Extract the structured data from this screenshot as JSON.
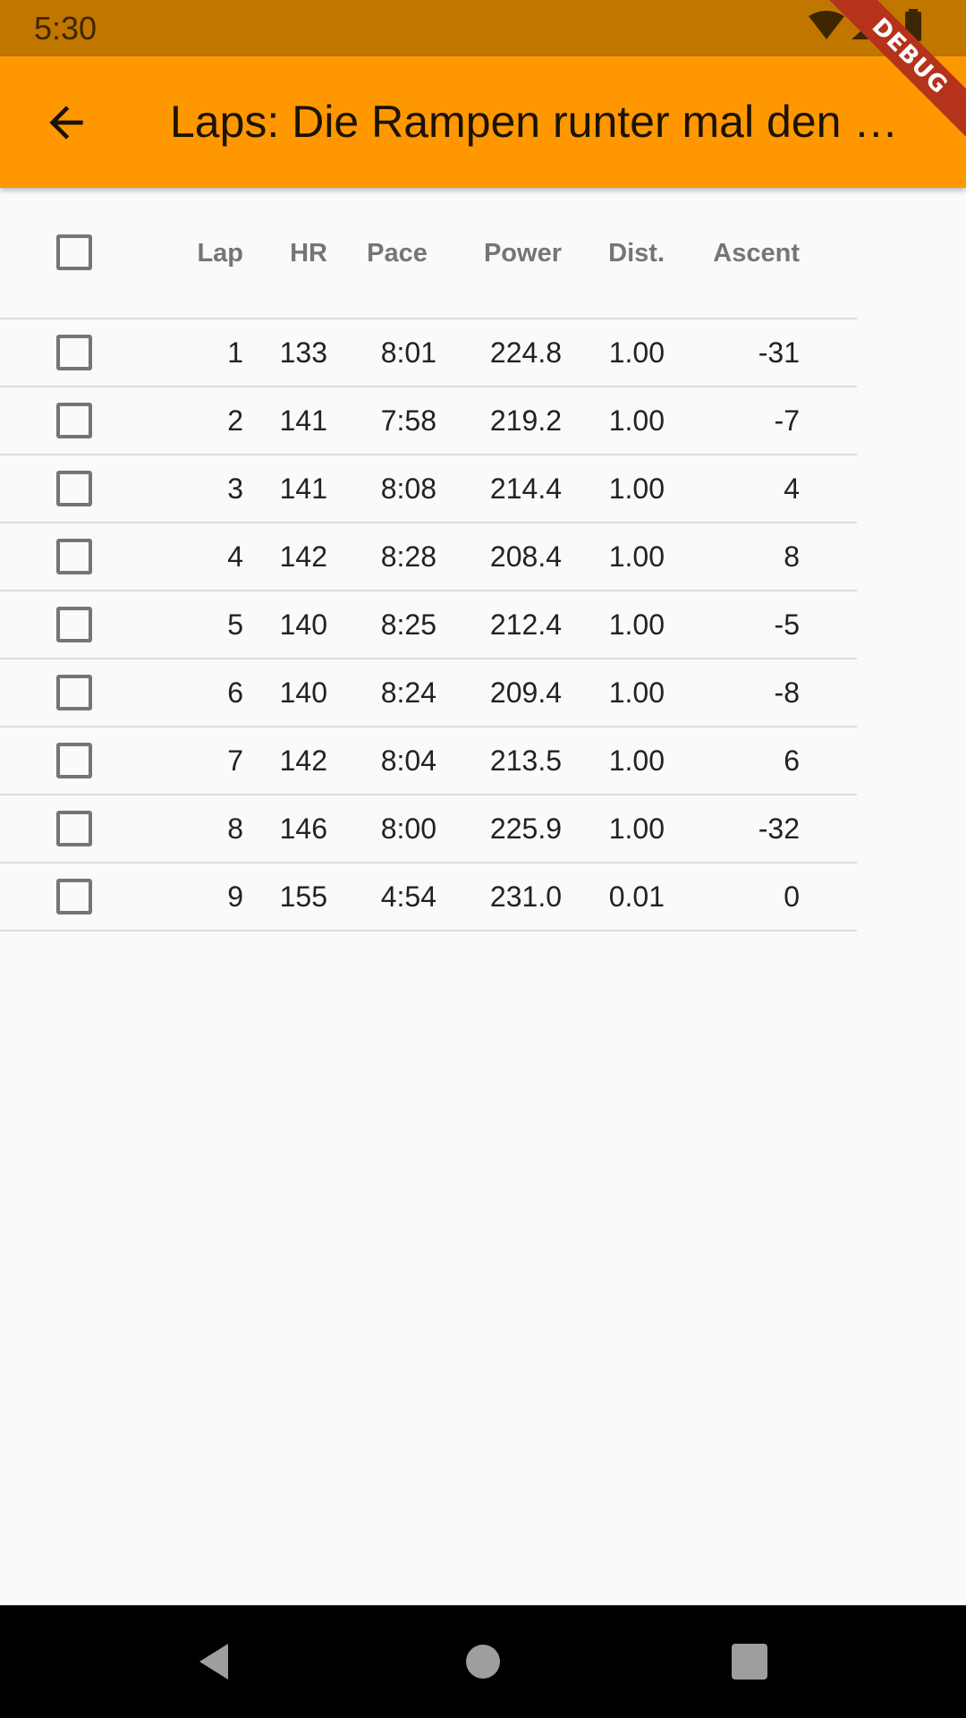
{
  "status_bar": {
    "time": "5:30"
  },
  "app_bar": {
    "title": "Laps: Die Rampen runter mal den …"
  },
  "debug_banner": {
    "label": "DEBUG"
  },
  "table": {
    "columns": [
      "Lap",
      "HR",
      "Pace",
      "Power",
      "Dist.",
      "Ascent"
    ],
    "rows": [
      {
        "lap": "1",
        "hr": "133",
        "pace": "8:01",
        "power": "224.8",
        "dist": "1.00",
        "ascent": "-31"
      },
      {
        "lap": "2",
        "hr": "141",
        "pace": "7:58",
        "power": "219.2",
        "dist": "1.00",
        "ascent": "-7"
      },
      {
        "lap": "3",
        "hr": "141",
        "pace": "8:08",
        "power": "214.4",
        "dist": "1.00",
        "ascent": "4"
      },
      {
        "lap": "4",
        "hr": "142",
        "pace": "8:28",
        "power": "208.4",
        "dist": "1.00",
        "ascent": "8"
      },
      {
        "lap": "5",
        "hr": "140",
        "pace": "8:25",
        "power": "212.4",
        "dist": "1.00",
        "ascent": "-5"
      },
      {
        "lap": "6",
        "hr": "140",
        "pace": "8:24",
        "power": "209.4",
        "dist": "1.00",
        "ascent": "-8"
      },
      {
        "lap": "7",
        "hr": "142",
        "pace": "8:04",
        "power": "213.5",
        "dist": "1.00",
        "ascent": "6"
      },
      {
        "lap": "8",
        "hr": "146",
        "pace": "8:00",
        "power": "225.9",
        "dist": "1.00",
        "ascent": "-32"
      },
      {
        "lap": "9",
        "hr": "155",
        "pace": "4:54",
        "power": "231.0",
        "dist": "0.01",
        "ascent": "0"
      }
    ]
  },
  "icons": {
    "back": "arrow-back-icon",
    "wifi": "wifi-icon",
    "signal": "signal-icon",
    "battery": "battery-icon",
    "nav_back": "nav-back-icon",
    "nav_home": "nav-home-icon",
    "nav_recents": "nav-recents-icon"
  },
  "colors": {
    "app_bar": "#ff9800",
    "status_bar": "#c17600",
    "debug_banner": "#b5331b",
    "background": "#fafafa"
  }
}
